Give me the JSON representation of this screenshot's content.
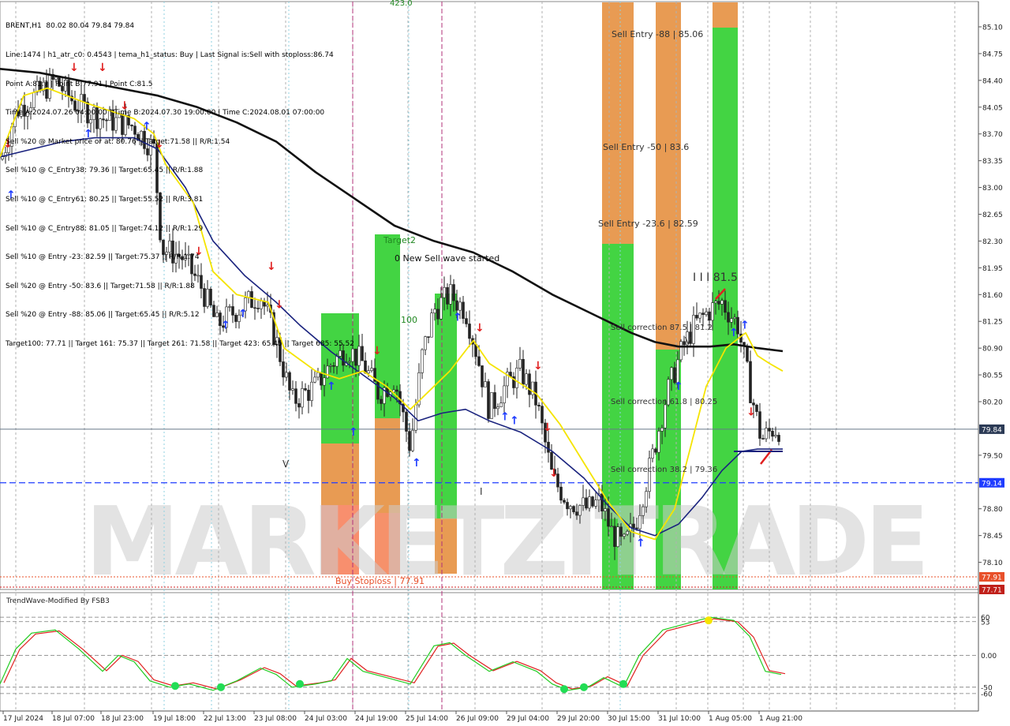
{
  "header": {
    "symbol_line": "BRENT,H1  80.02 80.04 79.84 79.84",
    "lines": [
      "Line:1474 | h1_atr_c0: 0.4543 | tema_h1_status: Buy | Last Signal is:Sell with stoploss:86.74",
      "Point A:81.7 | Point B:77.91 | Point C:81.5",
      "Time A:2024.07.26 04:00:00 | Time B:2024.07.30 19:00:00 | Time C:2024.08.01 07:00:00",
      "Sell %20 @ Market price or at: 80.76 || Target:71.58 || R/R:1.54",
      "Sell %10 @ C_Entry38: 79.36 || Target:65.45 || R/R:1.88",
      "Sell %10 @ C_Entry61: 80.25 || Target:55.52 || R/R:3.81",
      "Sell %10 @ C_Entry88: 81.05 || Target:74.12 || R/R:1.29",
      "Sell %10 @ Entry -23: 82.59 || Target:75.37 || R/R:1.74",
      "Sell %20 @ Entry -50: 83.6 || Target:71.58 || R/R:1.88",
      "Sell %20 @ Entry -88: 85.06 || Target:65.45 || R/R:5.12",
      "Target100: 77.71 || Target 161: 75.37 || Target 261: 71.58 || Target 423: 65.45 || Target 685: 55.52"
    ]
  },
  "labels": {
    "sell_entry_88": "Sell Entry -88 | 85.06",
    "sell_entry_50": "Sell Entry -50 | 83.6",
    "sell_entry_23": "Sell Entry -23.6 | 82.59",
    "sell_corr_875": "Sell correction 87.5 | 81.2",
    "sell_corr_618": "Sell correction 61.8 | 80.25",
    "sell_corr_382": "Sell correction 38.2 | 79.36",
    "point_c": "I I I 81.5",
    "target2": "Target2",
    "new_wave": "0 New Sell wave started",
    "hundred": "100",
    "buy_stoploss": "Buy Stoploss | 77.91",
    "v_mark": "V",
    "i_mark": "I",
    "top_cut": "423.0",
    "watermark": "MARKETZITRADE"
  },
  "price_tags": {
    "current": "79.84",
    "blue_line": "79.14",
    "stop": "77.91",
    "target": "77.71"
  },
  "colors": {
    "current_tag": "#2b3a55",
    "blue_tag": "#1f3cff",
    "red_tag": "#e8502a",
    "green_bar": "#22cc22",
    "orange_bar": "#e07a1a"
  },
  "chart_data": {
    "type": "candlestick",
    "symbol": "BRENT",
    "timeframe": "H1",
    "ylim": [
      77.71,
      85.25
    ],
    "y_ticks": [
      "85.10",
      "84.75",
      "84.40",
      "84.05",
      "83.70",
      "83.35",
      "83.00",
      "82.65",
      "82.30",
      "81.95",
      "81.60",
      "81.25",
      "80.90",
      "80.55",
      "80.20",
      "79.84",
      "79.50",
      "79.14",
      "78.80",
      "78.45",
      "78.10",
      "77.91",
      "77.71"
    ],
    "x_ticks": [
      "17 Jul 2024",
      "18 Jul 07:00",
      "18 Jul 23:00",
      "19 Jul 18:00",
      "22 Jul 13:00",
      "23 Jul 08:00",
      "24 Jul 03:00",
      "24 Jul 19:00",
      "25 Jul 14:00",
      "26 Jul 09:00",
      "29 Jul 04:00",
      "29 Jul 20:00",
      "30 Jul 15:00",
      "31 Jul 10:00",
      "1 Aug 05:00",
      "1 Aug 21:00"
    ],
    "close_path": [
      [
        0,
        83.3
      ],
      [
        20,
        84.0
      ],
      [
        45,
        84.2
      ],
      [
        70,
        84.4
      ],
      [
        95,
        84.1
      ],
      [
        130,
        83.9
      ],
      [
        170,
        83.8
      ],
      [
        195,
        83.5
      ],
      [
        205,
        82.2
      ],
      [
        230,
        82.1
      ],
      [
        255,
        81.7
      ],
      [
        275,
        81.2
      ],
      [
        300,
        81.4
      ],
      [
        330,
        81.6
      ],
      [
        350,
        81.0
      ],
      [
        370,
        80.2
      ],
      [
        400,
        80.4
      ],
      [
        420,
        80.7
      ],
      [
        440,
        80.9
      ],
      [
        460,
        80.7
      ],
      [
        480,
        80.3
      ],
      [
        500,
        80.5
      ],
      [
        520,
        79.6
      ],
      [
        535,
        80.8
      ],
      [
        550,
        81.4
      ],
      [
        570,
        81.6
      ],
      [
        590,
        81.4
      ],
      [
        605,
        80.8
      ],
      [
        620,
        80.1
      ],
      [
        640,
        80.4
      ],
      [
        660,
        80.6
      ],
      [
        680,
        80.2
      ],
      [
        700,
        79.2
      ],
      [
        720,
        78.9
      ],
      [
        745,
        78.8
      ],
      [
        760,
        78.9
      ],
      [
        775,
        78.5
      ],
      [
        790,
        78.3
      ],
      [
        805,
        78.6
      ],
      [
        825,
        79.4
      ],
      [
        845,
        80.3
      ],
      [
        865,
        80.9
      ],
      [
        880,
        81.2
      ],
      [
        900,
        81.4
      ],
      [
        915,
        81.5
      ],
      [
        935,
        81.2
      ],
      [
        950,
        80.4
      ],
      [
        965,
        79.7
      ],
      [
        980,
        79.85
      ],
      [
        992,
        79.84
      ]
    ],
    "tema_yellow": [
      [
        0,
        83.4
      ],
      [
        30,
        84.2
      ],
      [
        60,
        84.3
      ],
      [
        110,
        84.1
      ],
      [
        170,
        83.9
      ],
      [
        195,
        83.7
      ],
      [
        210,
        83.3
      ],
      [
        245,
        82.8
      ],
      [
        270,
        81.9
      ],
      [
        300,
        81.6
      ],
      [
        340,
        81.5
      ],
      [
        360,
        80.9
      ],
      [
        400,
        80.6
      ],
      [
        430,
        80.5
      ],
      [
        460,
        80.6
      ],
      [
        490,
        80.4
      ],
      [
        520,
        80.1
      ],
      [
        540,
        80.3
      ],
      [
        570,
        80.6
      ],
      [
        600,
        81.0
      ],
      [
        620,
        80.7
      ],
      [
        650,
        80.5
      ],
      [
        680,
        80.3
      ],
      [
        710,
        79.9
      ],
      [
        740,
        79.4
      ],
      [
        770,
        78.9
      ],
      [
        800,
        78.5
      ],
      [
        830,
        78.4
      ],
      [
        855,
        78.8
      ],
      [
        875,
        79.6
      ],
      [
        895,
        80.4
      ],
      [
        920,
        80.9
      ],
      [
        945,
        81.1
      ],
      [
        960,
        80.8
      ],
      [
        975,
        80.7
      ],
      [
        992,
        80.6
      ]
    ],
    "ma_navy": [
      [
        0,
        83.4
      ],
      [
        40,
        83.5
      ],
      [
        80,
        83.6
      ],
      [
        120,
        83.65
      ],
      [
        170,
        83.65
      ],
      [
        200,
        83.5
      ],
      [
        235,
        83.0
      ],
      [
        270,
        82.3
      ],
      [
        310,
        81.85
      ],
      [
        350,
        81.5
      ],
      [
        380,
        81.2
      ],
      [
        420,
        80.85
      ],
      [
        460,
        80.55
      ],
      [
        500,
        80.25
      ],
      [
        530,
        79.95
      ],
      [
        560,
        80.05
      ],
      [
        590,
        80.1
      ],
      [
        620,
        79.95
      ],
      [
        660,
        79.8
      ],
      [
        700,
        79.55
      ],
      [
        740,
        79.2
      ],
      [
        770,
        78.85
      ],
      [
        800,
        78.55
      ],
      [
        830,
        78.45
      ],
      [
        860,
        78.6
      ],
      [
        890,
        78.95
      ],
      [
        915,
        79.3
      ],
      [
        940,
        79.55
      ],
      [
        960,
        79.58
      ],
      [
        992,
        79.58
      ]
    ],
    "ma_black": [
      [
        0,
        84.55
      ],
      [
        50,
        84.5
      ],
      [
        100,
        84.4
      ],
      [
        150,
        84.3
      ],
      [
        200,
        84.2
      ],
      [
        250,
        84.05
      ],
      [
        300,
        83.85
      ],
      [
        350,
        83.6
      ],
      [
        400,
        83.2
      ],
      [
        450,
        82.85
      ],
      [
        500,
        82.5
      ],
      [
        550,
        82.3
      ],
      [
        600,
        82.15
      ],
      [
        650,
        81.9
      ],
      [
        700,
        81.6
      ],
      [
        750,
        81.35
      ],
      [
        800,
        81.1
      ],
      [
        830,
        80.98
      ],
      [
        860,
        80.92
      ],
      [
        900,
        80.92
      ],
      [
        930,
        80.95
      ],
      [
        960,
        80.9
      ],
      [
        992,
        80.86
      ]
    ],
    "oscillator": {
      "name": "TrendWave-Modified By FSB3",
      "levels": [
        "60",
        "53",
        "0.00",
        "-50",
        "-60"
      ],
      "ylim": [
        -80,
        80
      ],
      "series_green": [
        [
          0,
          -45
        ],
        [
          20,
          10
        ],
        [
          40,
          35
        ],
        [
          70,
          40
        ],
        [
          100,
          10
        ],
        [
          130,
          -25
        ],
        [
          150,
          0
        ],
        [
          170,
          -10
        ],
        [
          190,
          -40
        ],
        [
          215,
          -50
        ],
        [
          240,
          -45
        ],
        [
          270,
          -55
        ],
        [
          300,
          -40
        ],
        [
          330,
          -20
        ],
        [
          350,
          -30
        ],
        [
          370,
          -50
        ],
        [
          400,
          -45
        ],
        [
          420,
          -40
        ],
        [
          440,
          -5
        ],
        [
          460,
          -25
        ],
        [
          490,
          -35
        ],
        [
          520,
          -45
        ],
        [
          550,
          15
        ],
        [
          570,
          20
        ],
        [
          590,
          0
        ],
        [
          620,
          -25
        ],
        [
          650,
          -10
        ],
        [
          680,
          -25
        ],
        [
          700,
          -45
        ],
        [
          720,
          -55
        ],
        [
          745,
          -50
        ],
        [
          765,
          -35
        ],
        [
          790,
          -50
        ],
        [
          810,
          0
        ],
        [
          840,
          40
        ],
        [
          870,
          50
        ],
        [
          900,
          60
        ],
        [
          930,
          55
        ],
        [
          950,
          30
        ],
        [
          970,
          -25
        ],
        [
          990,
          -30
        ]
      ],
      "dots": [
        [
          222,
          -48
        ],
        [
          280,
          -50
        ],
        [
          380,
          -45
        ],
        [
          715,
          -53
        ],
        [
          740,
          -50
        ],
        [
          790,
          -45
        ]
      ],
      "yellow_dot": [
        898,
        55
      ]
    }
  }
}
